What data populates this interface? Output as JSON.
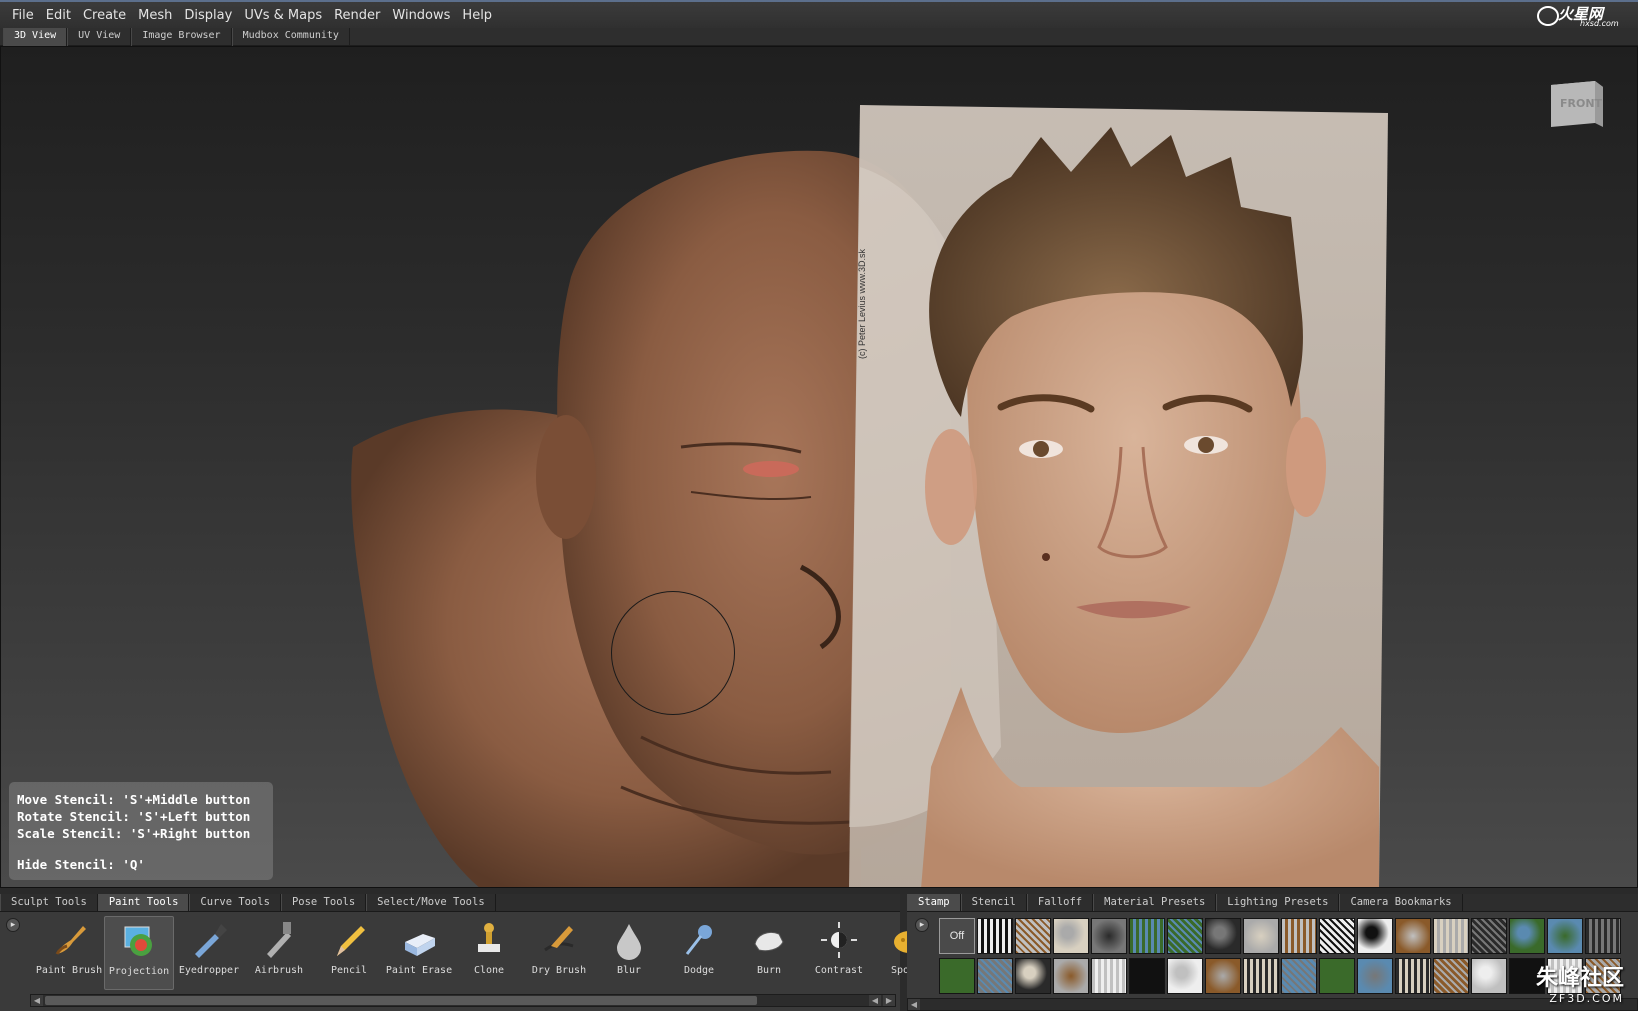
{
  "menu": {
    "items": [
      "File",
      "Edit",
      "Create",
      "Mesh",
      "Display",
      "UVs & Maps",
      "Render",
      "Windows",
      "Help"
    ]
  },
  "logo": {
    "text": "火星网",
    "sub": "hxsd.com"
  },
  "view_tabs": [
    "3D View",
    "UV View",
    "Image Browser",
    "Mudbox Community"
  ],
  "active_view_tab": "3D View",
  "viewport": {
    "view_cube_label": "FRONT",
    "stencil_credit": "(c) Peter Levius www.3D.sk",
    "help": {
      "line1": "Move Stencil: 'S'+Middle button",
      "line2": "Rotate Stencil: 'S'+Left button",
      "line3": "Scale Stencil: 'S'+Right button",
      "line4": "Hide Stencil: 'Q'"
    }
  },
  "tool_tabs": [
    "Sculpt Tools",
    "Paint Tools",
    "Curve Tools",
    "Pose Tools",
    "Select/Move Tools"
  ],
  "active_tool_tab": "Paint Tools",
  "paint_tools": [
    {
      "label": "Paint Brush",
      "icon": "paint-brush-icon"
    },
    {
      "label": "Projection",
      "icon": "projection-icon",
      "selected": true
    },
    {
      "label": "Eyedropper",
      "icon": "eyedropper-icon"
    },
    {
      "label": "Airbrush",
      "icon": "airbrush-icon"
    },
    {
      "label": "Pencil",
      "icon": "pencil-icon"
    },
    {
      "label": "Paint Erase",
      "icon": "eraser-icon"
    },
    {
      "label": "Clone",
      "icon": "clone-stamp-icon"
    },
    {
      "label": "Dry Brush",
      "icon": "dry-brush-icon"
    },
    {
      "label": "Blur",
      "icon": "blur-drop-icon"
    },
    {
      "label": "Dodge",
      "icon": "dodge-icon"
    },
    {
      "label": "Burn",
      "icon": "burn-hand-icon"
    },
    {
      "label": "Contrast",
      "icon": "contrast-icon"
    },
    {
      "label": "Sponge",
      "icon": "sponge-icon"
    }
  ],
  "tray_tabs": [
    "Stamp",
    "Stencil",
    "Falloff",
    "Material Presets",
    "Lighting Presets",
    "Camera Bookmarks"
  ],
  "active_tray_tab": "Stamp",
  "stamp": {
    "off_label": "Off"
  },
  "watermark": {
    "main": "朱峰社区",
    "sub": "ZF3D.COM"
  },
  "colors": {
    "skin": "#9a6a4e",
    "stencil_bg": "#c9bfb4",
    "accent": "#5c6f8c"
  }
}
